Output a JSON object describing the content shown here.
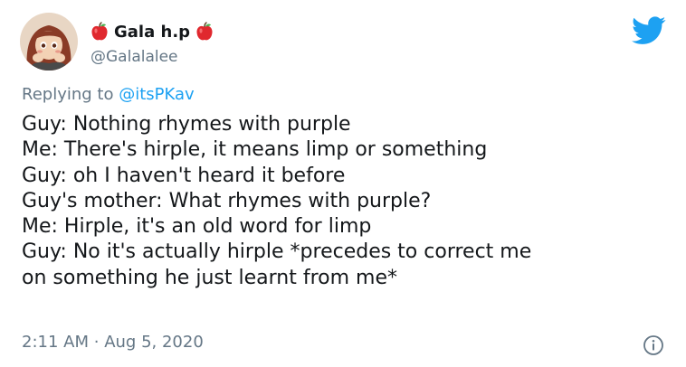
{
  "user": {
    "display_name": "Gala h.p",
    "handle": "@Galalalee",
    "name_emoji_icon": "red-apple-icon"
  },
  "reply": {
    "prefix": "Replying to",
    "to_handle": "@itsPKav"
  },
  "tweet": {
    "lines": [
      "Guy: Nothing rhymes with purple",
      "Me: There's hirple, it means limp or something",
      "Guy: oh I haven't heard it before",
      "Guy's mother: What rhymes with purple?",
      "Me: Hirple, it's an old word for limp",
      "Guy: No it's actually hirple *precedes to correct me",
      "on something he just learnt from me*"
    ]
  },
  "meta": {
    "time": "2:11 AM",
    "separator": "·",
    "date": "Aug 5, 2020"
  },
  "icons": {
    "brand": "twitter-bird-icon",
    "info": "info-icon"
  },
  "colors": {
    "twitter_blue": "#1da1f2",
    "secondary_text": "#657786",
    "primary_text": "#14171a",
    "apple_red": "#e0282e"
  }
}
